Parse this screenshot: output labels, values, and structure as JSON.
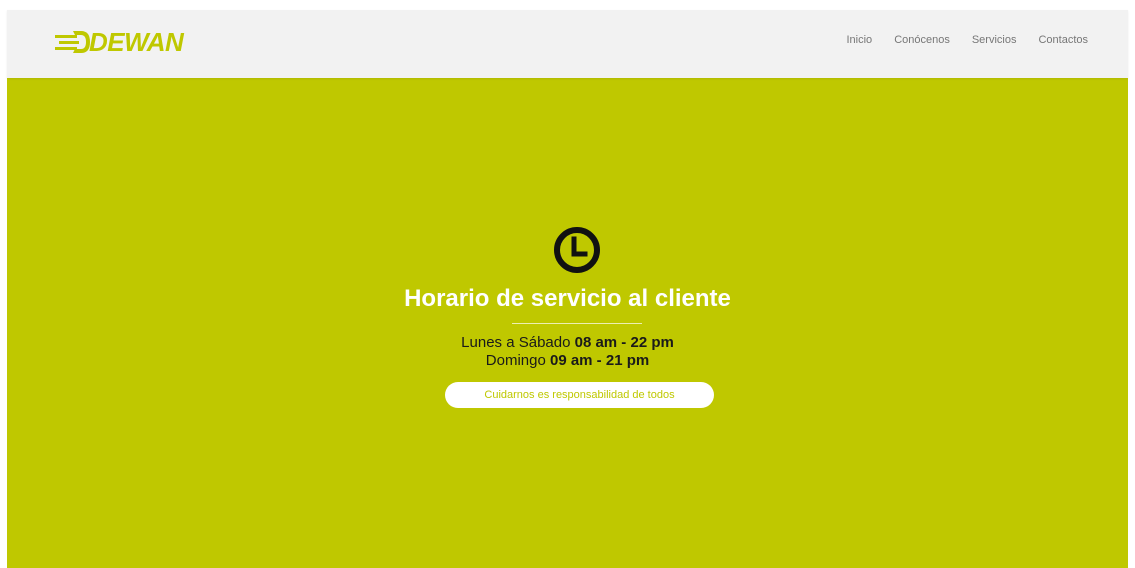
{
  "brand": {
    "name": "DEWAN",
    "color": "#bfc800"
  },
  "nav": {
    "items": [
      {
        "label": "Inicio"
      },
      {
        "label": "Conócenos"
      },
      {
        "label": "Servicios"
      },
      {
        "label": "Contactos"
      }
    ]
  },
  "hero": {
    "icon": "clock-icon",
    "title": "Horario de servicio al cliente",
    "weekday_label": "Lunes a Sábado",
    "weekday_hours": "08 am - 22 pm",
    "sunday_label": "Domingo",
    "sunday_hours": "09 am - 21 pm",
    "tagline": "Cuidarnos es responsabilidad de todos"
  },
  "colors": {
    "background": "#bfc800",
    "navbar": "#f2f2f2",
    "title": "#ffffff",
    "text": "#1a1a1a"
  }
}
